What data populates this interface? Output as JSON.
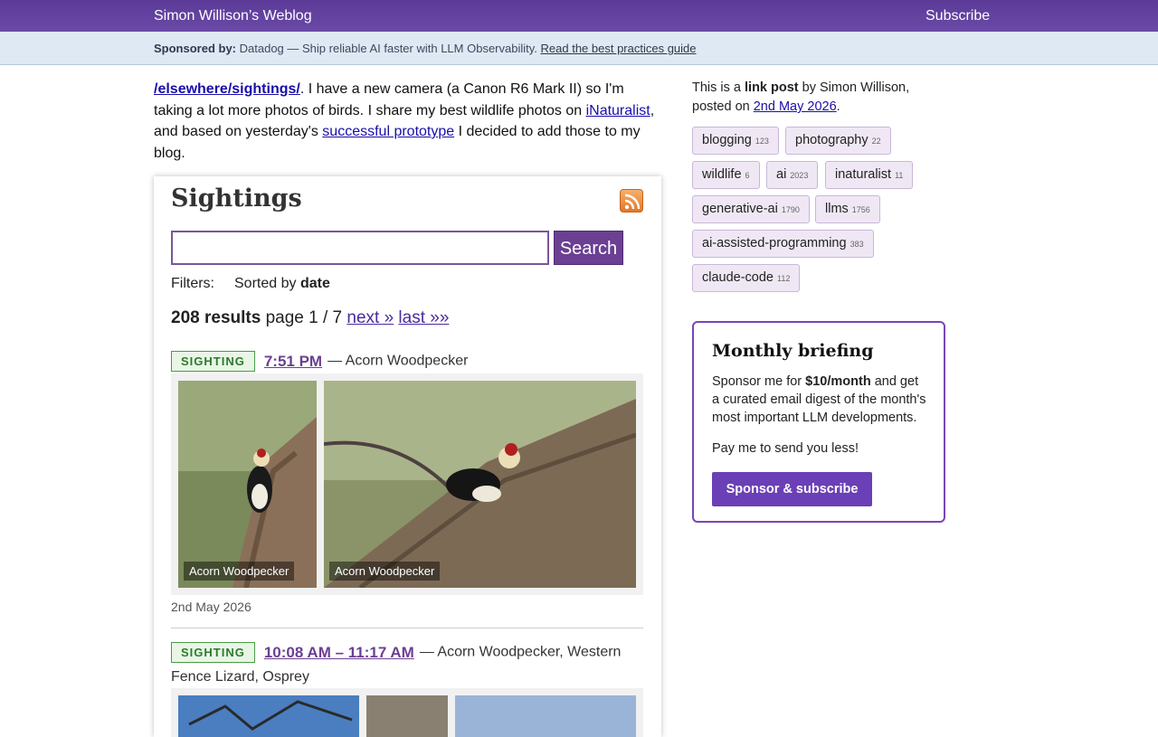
{
  "topbar": {
    "site_title": "Simon Willison’s Weblog",
    "subscribe": "Subscribe"
  },
  "sponsor": {
    "label": "Sponsored by:",
    "text": "Datadog — Ship reliable AI faster with LLM Observability.",
    "link": "Read the best practices guide"
  },
  "post": {
    "link_text": "/elsewhere/sightings/",
    "part1": ". I have a new camera (a Canon R6 Mark II) so I'm taking a lot more photos of birds. I share my best wildlife photos on ",
    "inat_link": "iNaturalist",
    "part2": ", and based on yesterday's ",
    "proto_link": "successful prototype",
    "part3": " I decided to add those to my blog."
  },
  "screenshot": {
    "title": "Sightings",
    "search_button": "Search",
    "filters_label": "Filters:",
    "sorted_prefix": "Sorted by ",
    "sorted_value": "date",
    "results_count": "208 results",
    "page_info": " page 1 / 7 ",
    "next": "next »",
    "last": "last »»",
    "sighting_badge": "SIGHTING",
    "sighting1_time": "7:51 PM",
    "sighting1_desc": "— Acorn Woodpecker",
    "photo1_caption": "Acorn Woodpecker",
    "photo2_caption": "Acorn Woodpecker",
    "sighting1_date": "2nd May 2026",
    "sighting2_time": "10:08 AM – 11:17 AM",
    "sighting2_desc": "— Acorn Woodpecker, Western",
    "sighting2_desc2": "Fence Lizard, Osprey"
  },
  "meta": {
    "prefix": "This is a ",
    "type": "link post",
    "by": " by Simon Willison, posted on ",
    "date": "2nd May 2026",
    "suffix": "."
  },
  "tags": [
    {
      "name": "blogging",
      "count": "123"
    },
    {
      "name": "photography",
      "count": "22"
    },
    {
      "name": "wildlife",
      "count": "6"
    },
    {
      "name": "ai",
      "count": "2023"
    },
    {
      "name": "inaturalist",
      "count": "11"
    },
    {
      "name": "generative-ai",
      "count": "1790"
    },
    {
      "name": "llms",
      "count": "1756"
    },
    {
      "name": "ai-assisted-programming",
      "count": "383"
    },
    {
      "name": "claude-code",
      "count": "112"
    }
  ],
  "briefing": {
    "title": "Monthly briefing",
    "text_pre": "Sponsor me for ",
    "price": "$10/month",
    "text_post": " and get a curated email digest of the month's most important LLM developments.",
    "text2": "Pay me to send you less!",
    "button": "Sponsor & subscribe"
  }
}
